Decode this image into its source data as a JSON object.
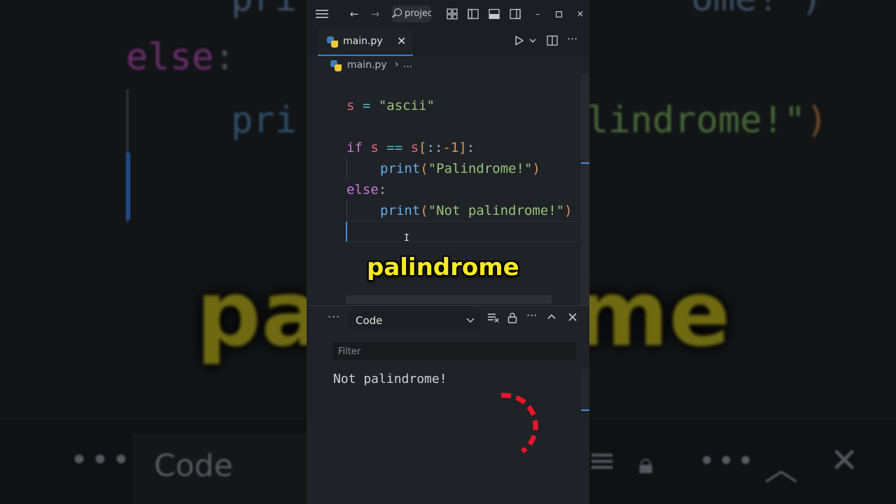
{
  "titlebar": {
    "search_text": "projec"
  },
  "tab": {
    "label": "main.py"
  },
  "breadcrumb": {
    "file": "main.py",
    "more": "..."
  },
  "code": {
    "line1": {
      "var": "s",
      "op": "=",
      "str": "\"ascii\""
    },
    "line3": {
      "kw": "if",
      "var": "s",
      "op": "==",
      "var2": "s",
      "slice_open": "[",
      "slice_mid": "::",
      "num": "-1",
      "slice_close": "]",
      "colon": ":"
    },
    "line4": {
      "fn": "print",
      "open": "(",
      "str": "\"Palindrome!\"",
      "close": ")"
    },
    "line5": {
      "kw": "else",
      "colon": ":"
    },
    "line6": {
      "fn": "print",
      "open": "(",
      "str": "\"Not palindrome!\"",
      "close": ")"
    }
  },
  "caption": "palindrome",
  "panel": {
    "select_label": "Code",
    "filter_placeholder": "Filter",
    "output": "Not palindrome!"
  },
  "colors": {
    "accent": "#2f7fd8",
    "caption": "#f4ea1f",
    "spinner": "#e8162a"
  }
}
